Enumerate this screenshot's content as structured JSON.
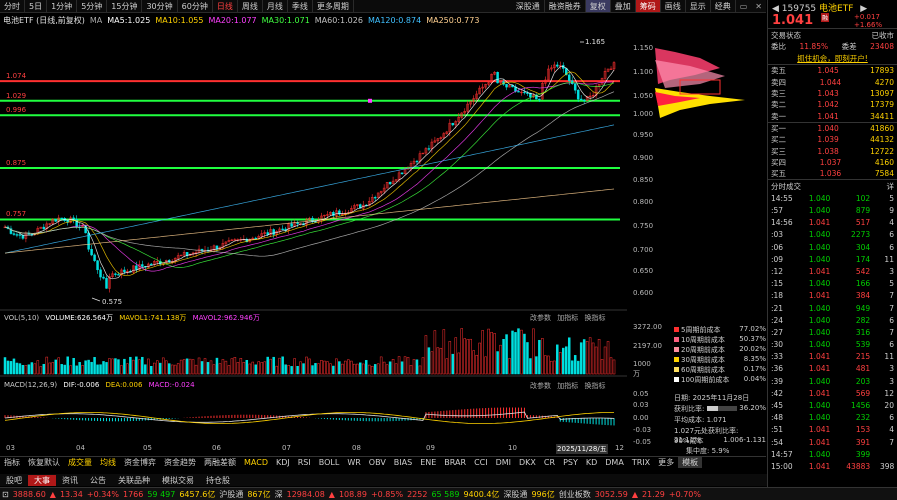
{
  "toolbar": {
    "tabs": [
      "分时",
      "5日",
      "1分钟",
      "5分钟",
      "15分钟",
      "30分钟",
      "60分钟",
      "日线",
      "周线",
      "月线",
      "季线",
      "更多周期"
    ],
    "active": "日线",
    "right": [
      "深股通",
      "融资融券",
      "复权",
      "叠加",
      "筹码",
      "画线",
      "显示",
      "经典"
    ]
  },
  "ma": {
    "title": "电池ETF (日线,前复权)",
    "ma_label": "MA",
    "ma5": "MA5:1.025",
    "ma10": "MA10:1.055",
    "ma20": "MA20:1.077",
    "ma30": "MA30:1.071",
    "ma60": "MA60:1.026",
    "ma120": "MA120:0.874",
    "ma250": "MA250:0.773"
  },
  "price_lines": [
    {
      "label": "1.074",
      "price": 1.074,
      "color": "#ff3030"
    },
    {
      "label": "1.029",
      "price": 1.029,
      "color": "#20ff40"
    },
    {
      "label": "0.996",
      "price": 0.996,
      "color": "#20ff40"
    },
    {
      "label": "0.875",
      "price": 0.875,
      "color": "#20ff40"
    },
    {
      "label": "0.757",
      "price": 0.757,
      "color": "#20ff40"
    }
  ],
  "annotations": {
    "high": "1.165",
    "low": "0.575"
  },
  "y_ticks": [
    "1.150",
    "1.100",
    "1.050",
    "1.000",
    "0.950",
    "0.900",
    "0.850",
    "0.800",
    "0.750",
    "0.700",
    "0.650",
    "0.600"
  ],
  "vol": {
    "title": "VOL(5,10)",
    "volume": "VOLUME:626.564万",
    "mavol1": "MAVOL1:741.138万",
    "mavol2": "MAVOL2:962.946万",
    "buttons": [
      "改参数",
      "加指标",
      "换指标"
    ],
    "y_ticks": [
      "3272.00",
      "2197.00",
      "1000",
      "万"
    ]
  },
  "macd": {
    "title": "MACD(12,26,9)",
    "dif": "DIF:-0.006",
    "dea": "DEA:0.006",
    "macd": "MACD:-0.024",
    "buttons": [
      "改参数",
      "加指标",
      "换指标"
    ],
    "y_ticks": [
      "0.05",
      "0.03",
      "0.00",
      "-0.03",
      "-0.05"
    ]
  },
  "cost": [
    {
      "label": "5周期前成本",
      "value": "77.02%",
      "color": "#ff3030"
    },
    {
      "label": "10周期前成本",
      "value": "50.37%",
      "color": "#ff6080"
    },
    {
      "label": "20周期前成本",
      "value": "20.02%",
      "color": "#ff90a0"
    },
    {
      "label": "30周期前成本",
      "value": "8.35%",
      "color": "#ffd200"
    },
    {
      "label": "60周期前成本",
      "value": "0.17%",
      "color": "#ffe060"
    },
    {
      "label": "100周期前成本",
      "value": "0.04%",
      "color": "#ffffff"
    }
  ],
  "cost_info": {
    "date": "日期: 2025年11月28日",
    "profit_label": "获利比率:",
    "profit": "36.20%",
    "avg": "平均成本: 1.071",
    "conc": "1.027元处获利比率: 21.11%",
    "range_label": "90%成本",
    "range": "1.006-1.131",
    "range_sub": "集中度: 5.9%"
  },
  "xaxis": [
    "03",
    "04",
    "05",
    "06",
    "07",
    "08",
    "09",
    "10",
    "2025/11/28/五",
    "12"
  ],
  "indicators": [
    "指标",
    "恢复默认",
    "成交量",
    "均线",
    "资金博弈",
    "资金趋势",
    "两融差额",
    "MACD",
    "KDJ",
    "RSI",
    "BOLL",
    "WR",
    "OBV",
    "BIAS",
    "ENE",
    "BRAR",
    "CCI",
    "DMI",
    "DKX",
    "CR",
    "PSY",
    "KD",
    "DMA",
    "TRIX",
    "更多",
    "模板"
  ],
  "btabs": [
    "股吧",
    "大事",
    "资讯",
    "公告",
    "关联品种",
    "模拟交易",
    "持仓股"
  ],
  "status": {
    "idx1": "3888.60",
    "ch1": "13.34",
    "pct1": "+0.34%",
    "v1": "1766",
    "v2": "59 497",
    "amt1": "6457.6亿",
    "hgt": "沪股通",
    "hgt_v": "867亿",
    "sz_label": "深",
    "sz": "12984.08",
    "sz_ch": "108.89",
    "sz_pct": "+0.85%",
    "s2": "2252",
    "s3": "65 589",
    "s_amt": "9400.4亿",
    "sgt": "深股通",
    "sgt_v": "996亿",
    "cyb": "创业板数",
    "cyb_v": "3052.59",
    "cyb_ch": "21.29",
    "cyb_pct": "+0.70%"
  },
  "quote": {
    "code": "159755",
    "name": "电池ETF",
    "tag": "融",
    "price": "1.041",
    "change": "+0.017",
    "pct": "+1.66%",
    "state_label": "交易状态",
    "state": "已收市",
    "wb_label": "委比",
    "wb": "11.85%",
    "wc_label": "委差",
    "wc": "23408",
    "promo": "抓住机会，即刻开户!"
  },
  "asks": [
    {
      "label": "卖五",
      "price": "1.045",
      "vol": "17893"
    },
    {
      "label": "卖四",
      "price": "1.044",
      "vol": "4270"
    },
    {
      "label": "卖三",
      "price": "1.043",
      "vol": "13097"
    },
    {
      "label": "卖二",
      "price": "1.042",
      "vol": "17379"
    },
    {
      "label": "卖一",
      "price": "1.041",
      "vol": "34411"
    }
  ],
  "bids": [
    {
      "label": "买一",
      "price": "1.040",
      "vol": "41860"
    },
    {
      "label": "买二",
      "price": "1.039",
      "vol": "44132"
    },
    {
      "label": "买三",
      "price": "1.038",
      "vol": "12722"
    },
    {
      "label": "买四",
      "price": "1.037",
      "vol": "4160"
    },
    {
      "label": "买五",
      "price": "1.036",
      "vol": "7584"
    }
  ],
  "trades_title": "分时成交",
  "trades_more": "详",
  "trades": [
    {
      "t": "14:55",
      "p": "1.040",
      "v": "102",
      "n": "5",
      "c": "g"
    },
    {
      "t": ":57",
      "p": "1.040",
      "v": "879",
      "n": "9",
      "c": "g"
    },
    {
      "t": "14:56",
      "p": "1.041",
      "v": "517",
      "n": "4",
      "c": "r"
    },
    {
      "t": ":03",
      "p": "1.040",
      "v": "2273",
      "n": "6",
      "c": "g"
    },
    {
      "t": ":06",
      "p": "1.040",
      "v": "304",
      "n": "6",
      "c": "g"
    },
    {
      "t": ":09",
      "p": "1.040",
      "v": "174",
      "n": "11",
      "c": "g"
    },
    {
      "t": ":12",
      "p": "1.041",
      "v": "542",
      "n": "3",
      "c": "r"
    },
    {
      "t": ":15",
      "p": "1.040",
      "v": "166",
      "n": "5",
      "c": "g"
    },
    {
      "t": ":18",
      "p": "1.041",
      "v": "384",
      "n": "7",
      "c": "r"
    },
    {
      "t": ":21",
      "p": "1.040",
      "v": "949",
      "n": "7",
      "c": "g"
    },
    {
      "t": ":24",
      "p": "1.040",
      "v": "282",
      "n": "6",
      "c": "g"
    },
    {
      "t": ":27",
      "p": "1.040",
      "v": "316",
      "n": "7",
      "c": "g"
    },
    {
      "t": ":30",
      "p": "1.040",
      "v": "539",
      "n": "6",
      "c": "g"
    },
    {
      "t": ":33",
      "p": "1.041",
      "v": "215",
      "n": "11",
      "c": "r"
    },
    {
      "t": ":36",
      "p": "1.041",
      "v": "481",
      "n": "3",
      "c": "r"
    },
    {
      "t": ":39",
      "p": "1.040",
      "v": "203",
      "n": "3",
      "c": "g"
    },
    {
      "t": ":42",
      "p": "1.041",
      "v": "569",
      "n": "12",
      "c": "r"
    },
    {
      "t": ":45",
      "p": "1.040",
      "v": "1456",
      "n": "20",
      "c": "g"
    },
    {
      "t": ":48",
      "p": "1.040",
      "v": "232",
      "n": "6",
      "c": "g"
    },
    {
      "t": ":51",
      "p": "1.041",
      "v": "153",
      "n": "4",
      "c": "r"
    },
    {
      "t": ":54",
      "p": "1.041",
      "v": "391",
      "n": "7",
      "c": "r"
    },
    {
      "t": "14:57",
      "p": "1.040",
      "v": "399",
      "n": "",
      "c": "g"
    },
    {
      "t": "15:00",
      "p": "1.041",
      "v": "43883",
      "n": "398",
      "c": "r"
    }
  ]
}
